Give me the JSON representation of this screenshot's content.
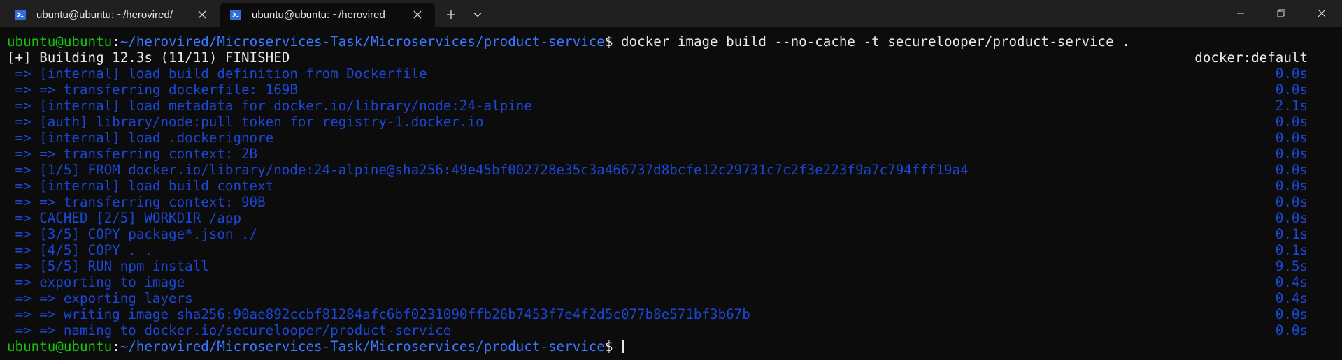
{
  "tabs": [
    {
      "title": "ubuntu@ubuntu: ~/herovired/",
      "active": false
    },
    {
      "title": "ubuntu@ubuntu: ~/herovired",
      "active": true
    }
  ],
  "prompt": {
    "user": "ubuntu@ubuntu",
    "colon": ":",
    "path": "~/herovired/Microservices-Task/Microservices/product-service",
    "symbol": "$ "
  },
  "command": "docker image build --no-cache -t securelooper/product-service .",
  "build_header": {
    "text": "[+] Building 12.3s (11/11) FINISHED",
    "builder": "docker:default"
  },
  "steps": [
    {
      "text": " => [internal] load build definition from Dockerfile",
      "time": "0.0s"
    },
    {
      "text": " => => transferring dockerfile: 169B",
      "time": "0.0s"
    },
    {
      "text": " => [internal] load metadata for docker.io/library/node:24-alpine",
      "time": "2.1s"
    },
    {
      "text": " => [auth] library/node:pull token for registry-1.docker.io",
      "time": "0.0s"
    },
    {
      "text": " => [internal] load .dockerignore",
      "time": "0.0s"
    },
    {
      "text": " => => transferring context: 2B",
      "time": "0.0s"
    },
    {
      "text": " => [1/5] FROM docker.io/library/node:24-alpine@sha256:49e45bf002728e35c3a466737d8bcfe12c29731c7c2f3e223f9a7c794fff19a4",
      "time": "0.0s"
    },
    {
      "text": " => [internal] load build context",
      "time": "0.0s"
    },
    {
      "text": " => => transferring context: 90B",
      "time": "0.0s"
    },
    {
      "text": " => CACHED [2/5] WORKDIR /app",
      "time": "0.0s"
    },
    {
      "text": " => [3/5] COPY package*.json ./",
      "time": "0.1s"
    },
    {
      "text": " => [4/5] COPY . .",
      "time": "0.1s"
    },
    {
      "text": " => [5/5] RUN npm install",
      "time": "9.5s"
    },
    {
      "text": " => exporting to image",
      "time": "0.4s"
    },
    {
      "text": " => => exporting layers",
      "time": "0.4s"
    },
    {
      "text": " => => writing image sha256:90ae892ccbf81284afc6bf0231090ffb26b7453f7e4f2d5c077b8e571bf3b67b",
      "time": "0.0s"
    },
    {
      "text": " => => naming to docker.io/securelooper/product-service",
      "time": "0.0s"
    }
  ],
  "colors": {
    "background": "#0c0c0c",
    "titlebar": "#202020",
    "prompt_user": "#16c60c",
    "prompt_path": "#3b78ff",
    "step_text": "#1b47d6",
    "foreground": "#e8e8e8"
  },
  "icons": {
    "tab_icon": "powershell-icon",
    "tab_close": "close-icon",
    "new_tab": "plus-icon",
    "dropdown": "chevron-down-icon",
    "minimize": "minimize-icon",
    "maximize": "restore-icon",
    "close_window": "close-window-icon"
  }
}
